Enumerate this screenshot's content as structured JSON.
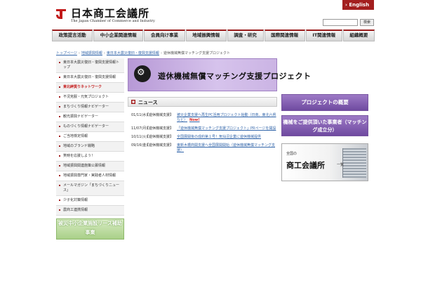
{
  "header": {
    "title": "日本商工会議所",
    "subtitle": "The Japan Chamber of Commerce and Industry",
    "english_label": "› English",
    "search_placeholder": "",
    "search_button": "検索"
  },
  "nav": [
    "政策提言活動",
    "中小企業関連情報",
    "会員向け事業",
    "地域振興情報",
    "調査・研究",
    "国際関連情報",
    "IT関連情報",
    "組織概要"
  ],
  "breadcrumb": {
    "items": [
      "トップページ",
      "地域振興情報",
      "東日本大震災復旧・復興支援情報",
      "遊休機械無償マッチング支援プロジェクト"
    ],
    "separator": "›"
  },
  "sidebar": {
    "items": [
      {
        "label": "東日本大震災復旧・復興支援情報トップ"
      },
      {
        "label": "東日本大震災復旧・復興支援情報"
      },
      {
        "label": "東北絆奨りネットワーク"
      },
      {
        "label": "不況克服・元気プロジェクト"
      },
      {
        "label": "まちづくり情報ナビゲーター"
      },
      {
        "label": "観光振興ナビゲーター"
      },
      {
        "label": "ものづくり情報ナビゲーター"
      },
      {
        "label": "ご当地検定情報"
      },
      {
        "label": "地域のブランド戦略"
      },
      {
        "label": "笑時を応援しよう！"
      },
      {
        "label": "地域振興関連施策公募情報"
      },
      {
        "label": "地域振興専門家・実践者人材情報"
      },
      {
        "label": "メールマガジン「まちづくりニュース」"
      },
      {
        "label": "少子化対策情報"
      },
      {
        "label": "農商工連携情報"
      }
    ],
    "banner": "被災中小企業施設リース補助事業"
  },
  "main": {
    "hero_title": "遊休機械無償マッチング支援プロジェクト",
    "news_title": "ニュース",
    "news": [
      {
        "date": "01/11(水)",
        "category": "【遊休機械支援】",
        "text": "被災企業支援へ再生PC活用プロジェクト始動（日商、東北六県など）",
        "new": "Now!"
      },
      {
        "date": "11/07(月)",
        "category": "【遊休機械支援】",
        "text": "「遊休機械無償マッチング支援プロジェクト」PRページを開設",
        "new": ""
      },
      {
        "date": "10/11(火)",
        "category": "【遊休機械支援】",
        "text": "全国展開後の成約第１号！気仙沼企業に遊休機械提供",
        "new": ""
      },
      {
        "date": "09/16(金)",
        "category": "【遊休機械支援】",
        "text": "東新木橋商開支援へ全国展開開始（遊休機械無償マッチング支援）",
        "new": ""
      }
    ]
  },
  "right": {
    "button_overview": "プロジェクトの概要",
    "button_providers": "機械をご提供頂いた事業者（マッチング成立分）",
    "banner_small": "全国の",
    "banner_big": "商工会議所",
    "banner_list": "一覧"
  },
  "colors": {
    "brand_red": "#a31f1f",
    "purple": "#6f4aa0",
    "link": "#3366aa"
  }
}
